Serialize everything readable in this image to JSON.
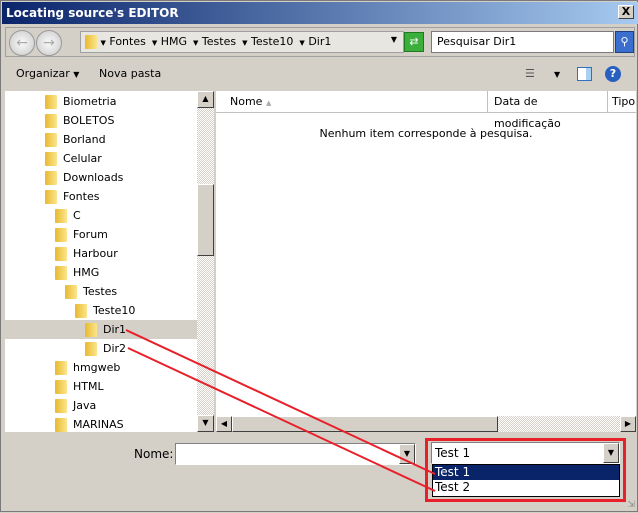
{
  "window": {
    "title": "Locating source's EDITOR",
    "close": "X"
  },
  "address": {
    "crumbs": [
      "Fontes",
      "HMG",
      "Testes",
      "Teste10",
      "Dir1"
    ],
    "search_placeholder": "Pesquisar Dir1"
  },
  "toolbar": {
    "organize": "Organizar",
    "new_folder": "Nova pasta"
  },
  "tree": [
    {
      "label": "Biometria",
      "level": 0
    },
    {
      "label": "BOLETOS",
      "level": 0
    },
    {
      "label": "Borland",
      "level": 0
    },
    {
      "label": "Celular",
      "level": 0
    },
    {
      "label": "Downloads",
      "level": 0
    },
    {
      "label": "Fontes",
      "level": 0
    },
    {
      "label": "C",
      "level": 1
    },
    {
      "label": "Forum",
      "level": 1
    },
    {
      "label": "Harbour",
      "level": 1
    },
    {
      "label": "HMG",
      "level": 1
    },
    {
      "label": "Testes",
      "level": 2
    },
    {
      "label": "Teste10",
      "level": 3
    },
    {
      "label": "Dir1",
      "level": 4,
      "selected": true
    },
    {
      "label": "Dir2",
      "level": 4
    },
    {
      "label": "hmgweb",
      "level": 1
    },
    {
      "label": "HTML",
      "level": 1
    },
    {
      "label": "Java",
      "level": 1
    },
    {
      "label": "MARINAS",
      "level": 1
    }
  ],
  "columns": {
    "name": "Nome",
    "modified": "Data de modificação",
    "type": "Tipo"
  },
  "empty_message": "Nenhum item corresponde à pesquisa.",
  "footer": {
    "name_label": "Nome:",
    "name_value": "",
    "filter_selected": "Test 1",
    "filter_options": [
      "Test 1",
      "Test 2"
    ]
  },
  "colors": {
    "annotation": "#e8202a",
    "selection": "#0a246a"
  }
}
